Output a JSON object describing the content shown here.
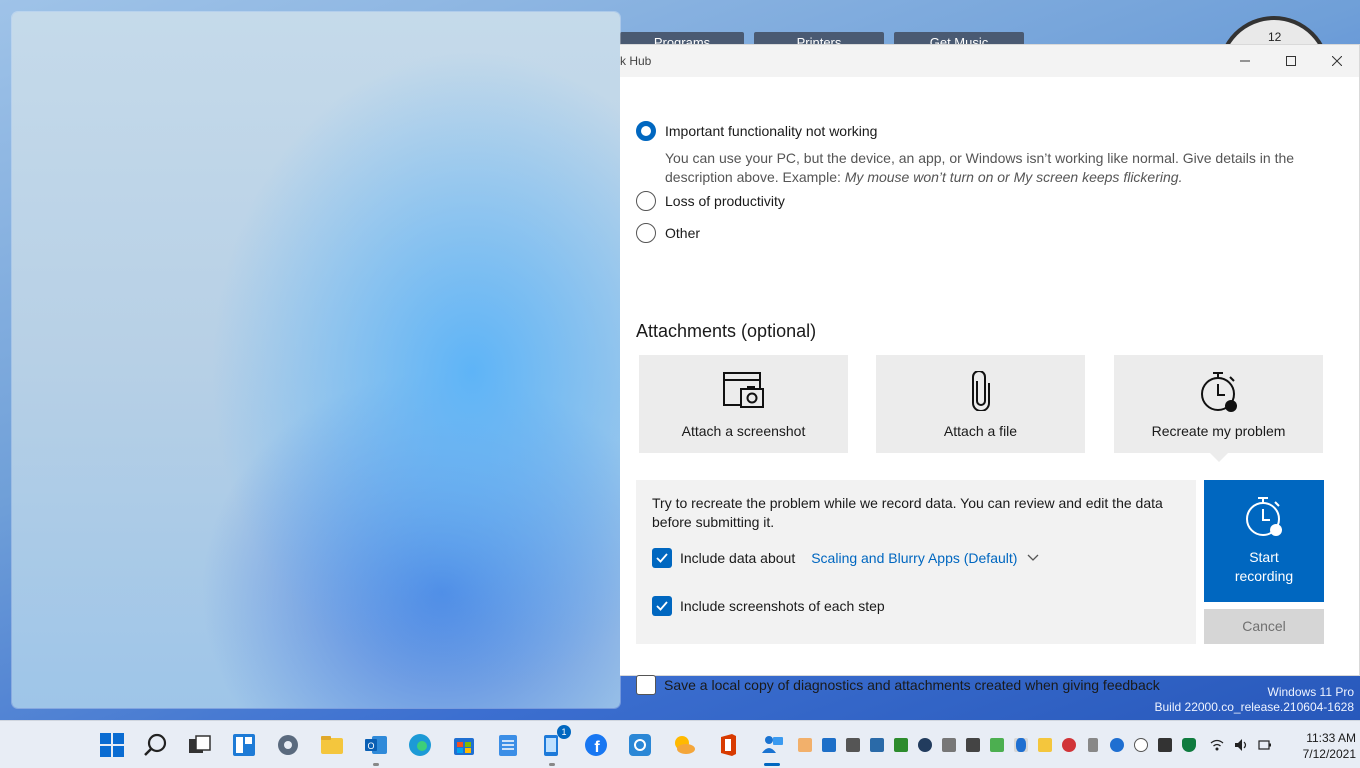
{
  "desktop": {
    "tabs": [
      "Programs",
      "Printers",
      "Get Music"
    ],
    "clock_numeral": "12",
    "watermark_edition": "Windows 11 Pro",
    "watermark_build": "Build 22000.co_release.210604-1628"
  },
  "window": {
    "title": "k Hub",
    "controls": {
      "minimize": "—",
      "maximize": "☐",
      "close": "✕"
    }
  },
  "impact": {
    "options": [
      {
        "label": "Important functionality not working",
        "checked": true
      },
      {
        "label": "Loss of productivity",
        "checked": false
      },
      {
        "label": "Other",
        "checked": false
      }
    ],
    "description_plain": "You can use your PC, but the device, an app, or Windows isn’t working like normal. Give details in the description above. Example: ",
    "description_example": "My mouse won’t turn on or My screen keeps flickering."
  },
  "attachments": {
    "title": "Attachments (optional)",
    "tiles": [
      {
        "label": "Attach a screenshot",
        "icon": "screenshot-icon"
      },
      {
        "label": "Attach a file",
        "icon": "paperclip-icon"
      },
      {
        "label": "Recreate my problem",
        "icon": "stopwatch-icon"
      }
    ]
  },
  "recording": {
    "description": "Try to recreate the problem while we record data. You can review and edit the data before submitting it.",
    "include_data_label": "Include data about",
    "include_data_checked": true,
    "data_category": "Scaling and Blurry Apps (Default)",
    "include_screenshots_label": "Include screenshots of each step",
    "include_screenshots_checked": true,
    "start_label_line1": "Start",
    "start_label_line2": "recording",
    "cancel_label": "Cancel"
  },
  "save_local": {
    "label": "Save a local copy of diagnostics and attachments created when giving feedback",
    "checked": false
  },
  "taskbar": {
    "notification_badge": "1",
    "time": "11:33 AM",
    "date": "7/12/2021",
    "accent": "#0067c0"
  }
}
